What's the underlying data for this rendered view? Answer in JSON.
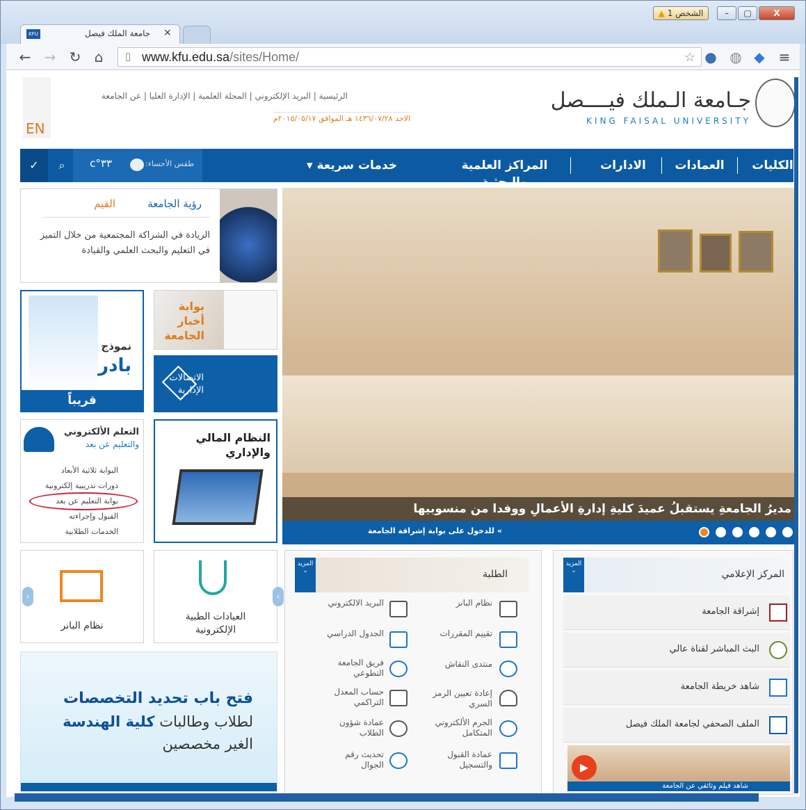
{
  "browser": {
    "tab_title": "جامعة الملك فيصل",
    "tab_favicon": "KFU",
    "tab_close": "×",
    "profile_label": "الشخص 1",
    "win_min": "–",
    "win_max": "▢",
    "win_close": "X",
    "url_domain": "www.kfu.edu.sa",
    "url_path": "/sites/Home/",
    "icons": [
      "back-icon",
      "forward-icon",
      "reload-icon",
      "home-icon",
      "page-icon",
      "star-icon",
      "person-icon",
      "globe-icon",
      "diamond-icon",
      "menu-icon"
    ]
  },
  "header": {
    "lang_toggle": "EN",
    "top_links": [
      "الرئيسية",
      "البريد الإلكتروني",
      "المجلة العلمية",
      "الإدارة العليا",
      "عن الجامعة"
    ],
    "date": "الاحد  ١٤٣٦/٠٧/٢٨ هـ الموافق  ٢٠١٥/٠٥/١٧م",
    "logo_ar": "جـامعة الـملك فيــــصل",
    "logo_en": "KING FAISAL UNIVERSITY"
  },
  "nav": {
    "items": [
      "الكليات",
      "العمادات",
      "الادارات",
      "المراكز العلمية والبحثية",
      "خدمات سريعة"
    ],
    "weather_label": "طقس الأحساء:",
    "temperature": "٣٣°c"
  },
  "vision": {
    "tab_vision": "رؤية الجامعة",
    "tab_values": "القيم",
    "text": "الريادة في الشراكة المجتمعية من خلال التميز في التعليم والبحث العلمي والقيادة"
  },
  "tiles": {
    "news_portal": "بوابة أخبار الجامعة",
    "badir_model": "نموذج",
    "badir": "بادر",
    "soon": "قريباً",
    "admin_comm": "الاتصالات الإدارية",
    "finance": "النظام المالي والإداري"
  },
  "elearning": {
    "title": "التعلم الألكتروني",
    "subtitle": "والتعليم عن بعد",
    "items": [
      "البوابة ثلاثية الأبعاد",
      "دورات تدريبية إلكترونية",
      "بوابة التعليم عن بعد",
      "القبول وإجراءته",
      "الخدمات الطلابية"
    ]
  },
  "slider": {
    "headline": "مديرُ الجامعةِ يستقبلُ عميدَ كليةِ إدارةِ الأعمالِ ووفدا من منسوبيها",
    "portal_link": "» للدخول على بوابة إشراقة الجامعة",
    "dots": 6,
    "active_dot": 6
  },
  "carousel": {
    "item1": "العيادات الطبية الإلكترونية",
    "item2": "نظام البانر"
  },
  "banner": {
    "line1": "فتح باب تحديد التخصصات",
    "line2a": "لطلاب وطالبات ",
    "line2b": "كلية الهندسة",
    "line3": "الغير مخصصين"
  },
  "students": {
    "title": "الطلبة",
    "more": "المزيد",
    "services": [
      [
        "نظام البانر",
        "البريد الالكتروني"
      ],
      [
        "تقييم المقررات",
        "الجدول الدراسي"
      ],
      [
        "منتدى النقاش",
        "فريق الجامعة التطوعي"
      ],
      [
        "إعادة تعيين الرمز السري",
        "حساب المعدل التراكمي"
      ],
      [
        "الجرم الألكتروني المتكامل",
        "عمادة شؤون الطلاب"
      ],
      [
        "عمادة القبول والتسجيل",
        "تحديث رقم الجوال"
      ]
    ]
  },
  "media": {
    "title": "المركز الإعلامي",
    "more": "المزيد",
    "items": [
      "إشراقة الجامعة",
      "البث المباشر لقناة عالي",
      "شاهد خريطة الجامعة",
      "الملف الصحفي لجامعة الملك فيصل"
    ],
    "video_caption": "شاهد فيلم وثائقي عن الجامعة"
  },
  "colors": {
    "primary": "#0c5ba2",
    "accent": "#f0861e",
    "brand_red": "#9c1f2b"
  }
}
